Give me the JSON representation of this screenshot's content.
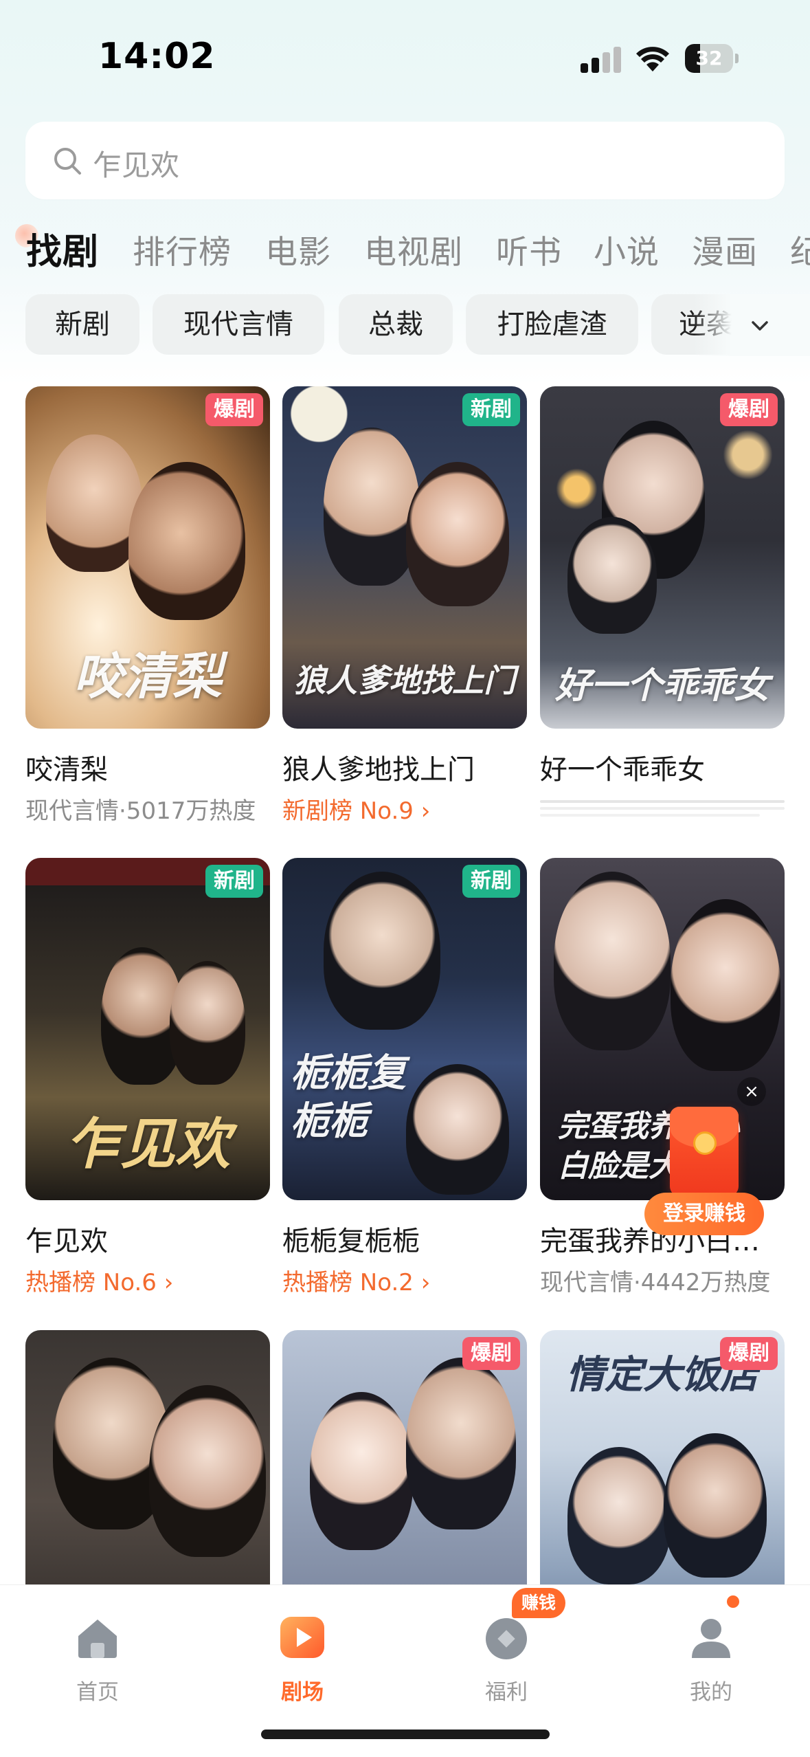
{
  "status_bar": {
    "time": "14:02",
    "battery": "32",
    "battery_level": 0.32
  },
  "search": {
    "placeholder": "乍见欢"
  },
  "tabs": [
    {
      "label": "找剧",
      "active": true
    },
    {
      "label": "排行榜"
    },
    {
      "label": "电影"
    },
    {
      "label": "电视剧"
    },
    {
      "label": "听书"
    },
    {
      "label": "小说"
    },
    {
      "label": "漫画"
    },
    {
      "label": "纪"
    }
  ],
  "chips": [
    "新剧",
    "现代言情",
    "总裁",
    "打脸虐渣",
    "逆袭"
  ],
  "cards": [
    {
      "title": "咬清梨",
      "subtitle": "现代言情·5017万热度",
      "badge": "爆剧",
      "poster_text": "咬清梨"
    },
    {
      "title": "狼人爹地找上门",
      "subtitle": "新剧榜 No.9 ›",
      "badge": "新剧",
      "poster_text": "狼人爹地找上门"
    },
    {
      "title": "好一个乖乖女",
      "subtitle": "",
      "badge": "爆剧",
      "poster_text": "好一个乖乖女"
    },
    {
      "title": "乍见欢",
      "subtitle": "热播榜 No.6 ›",
      "badge": "新剧",
      "poster_text": "乍见欢"
    },
    {
      "title": "栀栀复栀栀",
      "subtitle": "热播榜 No.2 ›",
      "badge": "新剧",
      "poster_text": "栀栀复栀栀"
    },
    {
      "title": "完蛋我养的小白…",
      "subtitle": "现代言情·4442万热度",
      "badge": "",
      "poster_text": "完蛋我养的小白脸是大佬"
    },
    {
      "title": "",
      "subtitle": "",
      "badge": "",
      "poster_text": ""
    },
    {
      "title": "",
      "subtitle": "",
      "badge": "爆剧",
      "poster_text": ""
    },
    {
      "title": "",
      "subtitle": "",
      "badge": "爆剧",
      "poster_text": "情定大饭店"
    }
  ],
  "floating": {
    "close": "×",
    "button": "登录赚钱"
  },
  "bottom_nav": [
    {
      "label": "首页",
      "icon": "home-icon"
    },
    {
      "label": "剧场",
      "icon": "play-icon",
      "active": true
    },
    {
      "label": "福利",
      "icon": "coin-icon",
      "badge": "赚钱"
    },
    {
      "label": "我的",
      "icon": "profile-icon"
    }
  ],
  "colors": {
    "accent": "#ff6a2b",
    "hot_badge": "#f55a6a",
    "new_badge": "#20b48a",
    "rank_text": "#f36a2e"
  }
}
